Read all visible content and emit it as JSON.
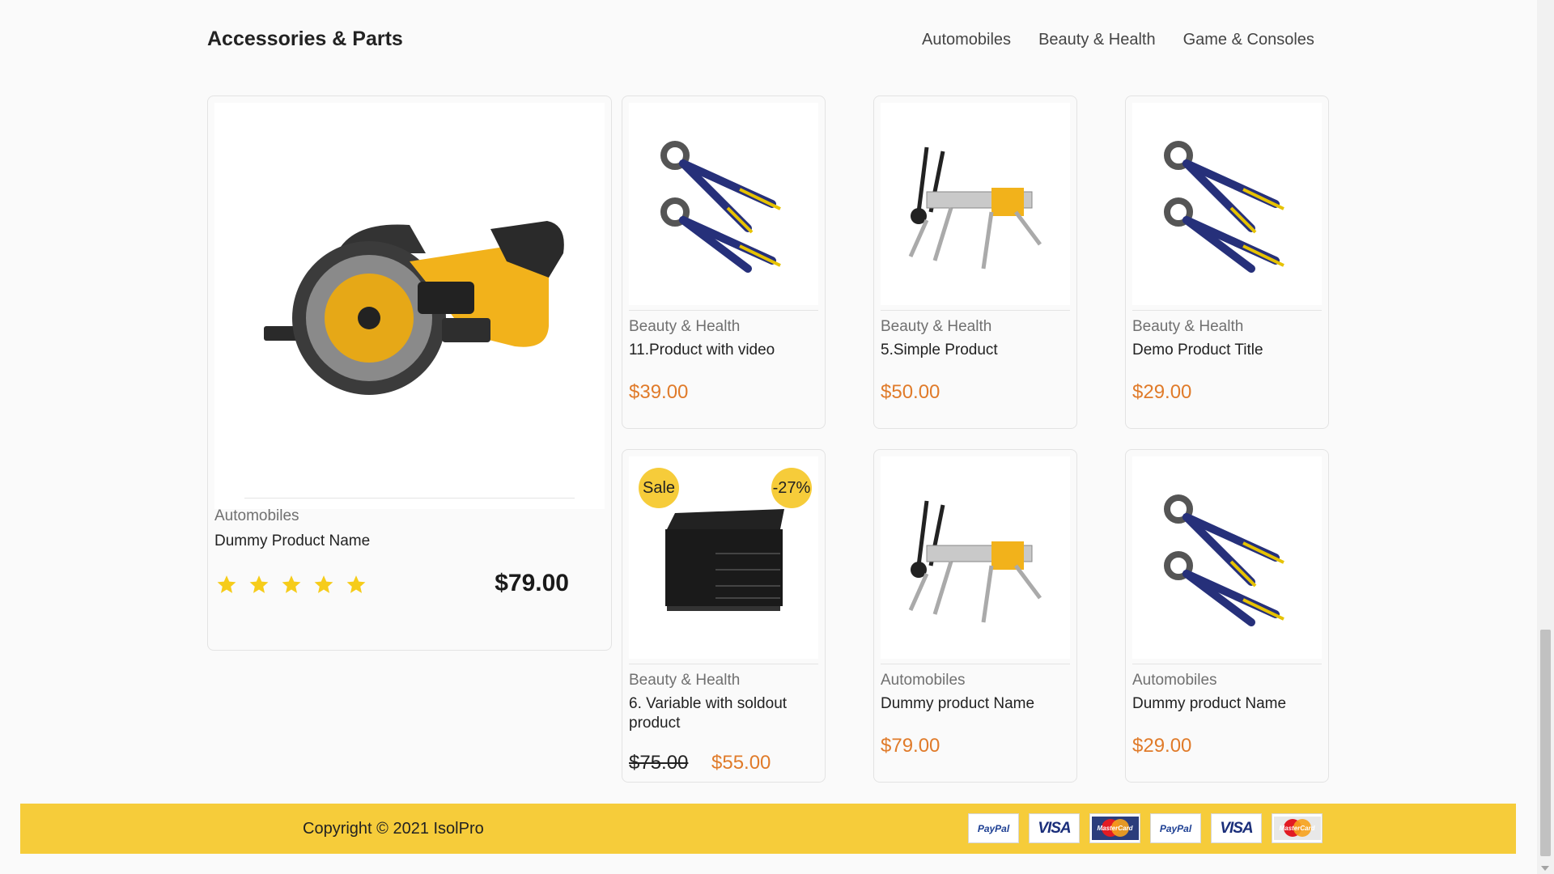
{
  "section": {
    "title": "Accessories & Parts",
    "tabs": [
      "Automobiles",
      "Beauty & Health",
      "Game & Consoles"
    ]
  },
  "featured": {
    "image_icon": "circular-saw-icon",
    "category": "Automobiles",
    "name": "Dummy Product Name",
    "rating": 5,
    "price": "$79.00"
  },
  "products": [
    {
      "image_icon": "pliers-icon",
      "category": "Beauty & Health",
      "name": "11.Product with video",
      "price": "$39.00"
    },
    {
      "image_icon": "work-stand-icon",
      "category": "Beauty & Health",
      "name": "5.Simple Product",
      "price": "$50.00"
    },
    {
      "image_icon": "pliers-icon",
      "category": "Beauty & Health",
      "name": "Demo Product Title",
      "price": "$29.00"
    },
    {
      "image_icon": "tool-chest-icon",
      "category": "Beauty & Health",
      "name": "6. Variable with soldout product",
      "old_price": "$75.00",
      "price": "$55.00",
      "badge_sale": "Sale",
      "badge_discount": "-27%"
    },
    {
      "image_icon": "work-stand-icon",
      "category": "Automobiles",
      "name": "Dummy product Name",
      "price": "$79.00"
    },
    {
      "image_icon": "pliers-icon",
      "category": "Automobiles",
      "name": "Dummy product Name",
      "price": "$29.00"
    }
  ],
  "footer": {
    "copyright": "Copyright © 2021 IsolPro",
    "payment_icons": [
      "paypal-icon",
      "visa-icon",
      "mastercard-icon",
      "paypal-icon",
      "visa-icon",
      "mastercard-icon"
    ],
    "paypal_text": "PayPal",
    "visa_text": "VISA",
    "mastercard_text": "MasterCard"
  },
  "colors": {
    "accent_yellow": "#f6cc3a",
    "price_orange": "#e07b2a"
  }
}
